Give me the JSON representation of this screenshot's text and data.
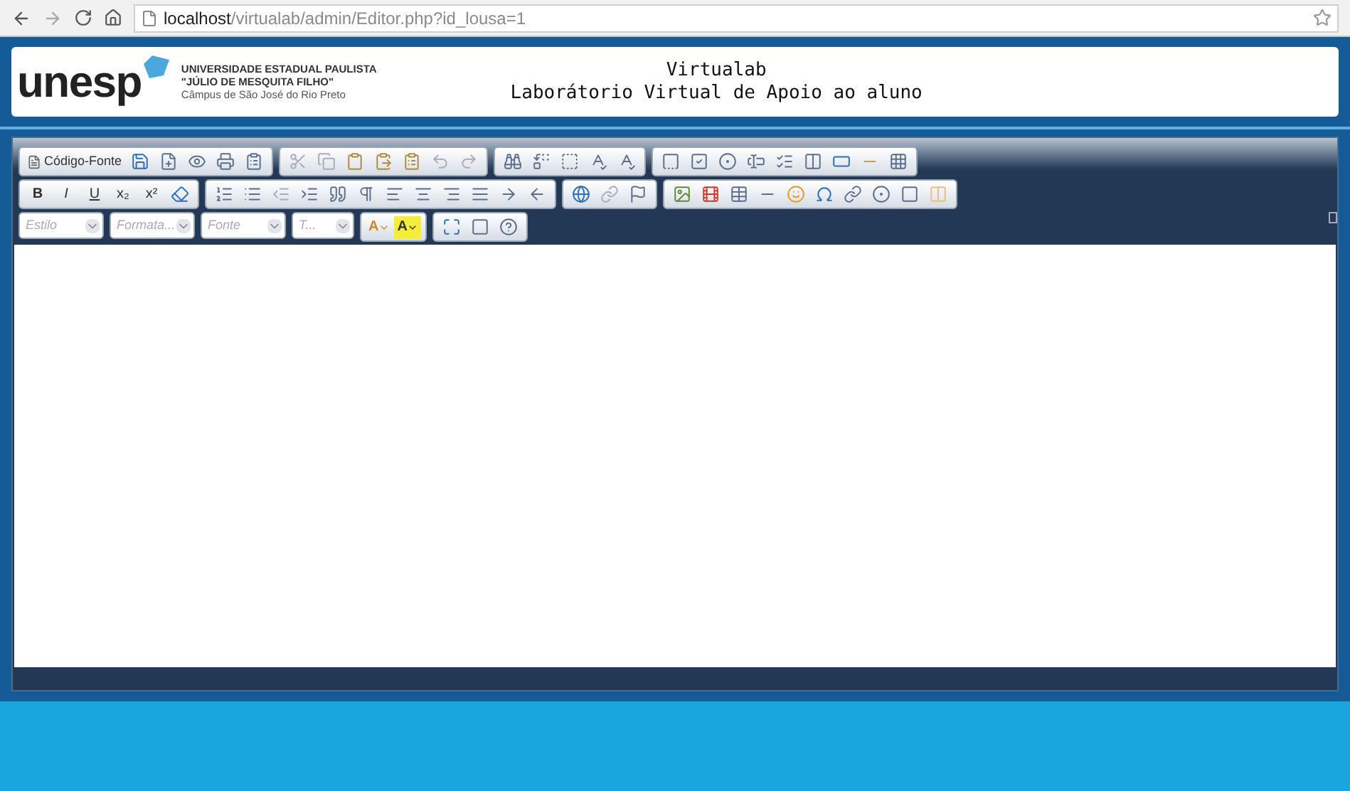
{
  "browser": {
    "url_host": "localhost",
    "url_path": "/virtualab/admin/Editor.php?id_lousa=1"
  },
  "header": {
    "logo": "unesp",
    "university": "UNIVERSIDADE ESTADUAL PAULISTA",
    "subtitle": "\"JÚLIO DE MESQUITA FILHO\"",
    "campus": "Câmpus de São José do Rio Preto",
    "title": "Virtualab",
    "tagline": "Laborátorio Virtual de Apoio ao aluno"
  },
  "toolbar": {
    "source_button": "Código-Fonte",
    "format_buttons": [
      "B",
      "I",
      "U",
      "x₂",
      "x²"
    ],
    "combos": [
      {
        "placeholder": "Estilo"
      },
      {
        "placeholder": "Formata..."
      },
      {
        "placeholder": "Fonte"
      },
      {
        "placeholder": "T..."
      }
    ],
    "color_buttons": [
      "A",
      "A"
    ]
  }
}
